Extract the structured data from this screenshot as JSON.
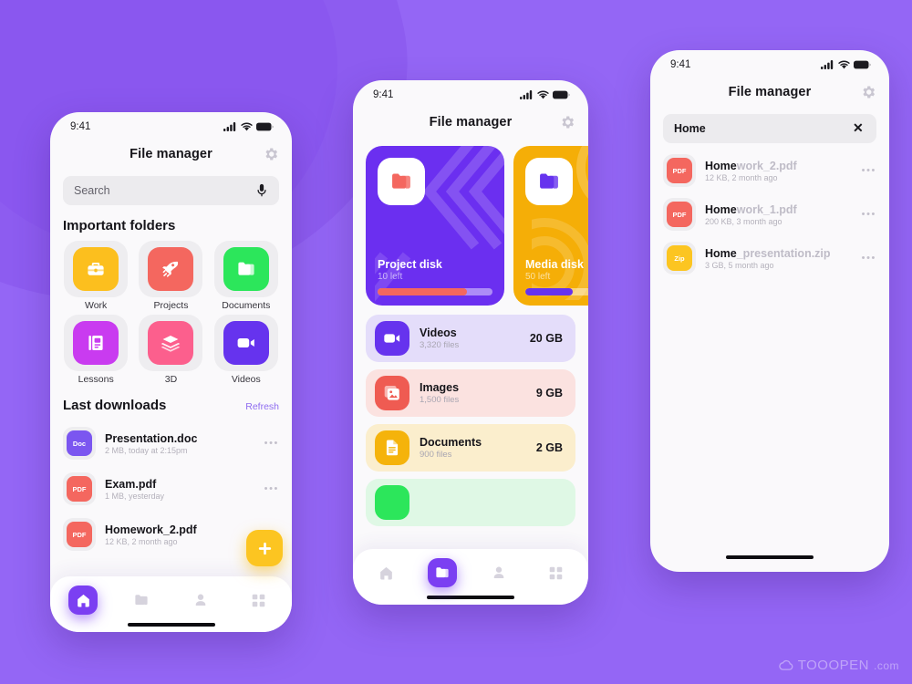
{
  "theme": {
    "background": "#9466f5",
    "blob": "#8d5cf0",
    "accent_purple": "#7b3ff2",
    "accent_yellow": "#fcc521",
    "accent_red": "#f4675f",
    "accent_green": "#2ce65b",
    "accent_pink": "#fc5f8d",
    "accent_magenta": "#c93bf0",
    "card_surface": "#faf9fb"
  },
  "watermark": {
    "brand": "TOOOPEN",
    "suffix": ".com",
    "icon": "cloud-icon"
  },
  "phone1": {
    "status": {
      "time": "9:41",
      "signal_icon": "cellular-signal-icon",
      "wifi_icon": "wifi-icon",
      "battery_icon": "battery-icon"
    },
    "header": {
      "title": "File manager",
      "settings_icon": "gear-icon"
    },
    "search": {
      "placeholder": "Search",
      "value": "",
      "mic_icon": "microphone-icon"
    },
    "folders_section": {
      "title": "Important folders"
    },
    "folders": [
      {
        "label": "Work",
        "icon": "briefcase-icon",
        "color": "#fcbf1e"
      },
      {
        "label": "Projects",
        "icon": "rocket-icon",
        "color": "#f4675f"
      },
      {
        "label": "Documents",
        "icon": "folder-icon",
        "color": "#2ce65b"
      },
      {
        "label": "Lessons",
        "icon": "book-icon",
        "color": "#c93bf0"
      },
      {
        "label": "3D",
        "icon": "layers-icon",
        "color": "#fc5f8d"
      },
      {
        "label": "Videos",
        "icon": "video-camera-icon",
        "color": "#6633ee"
      }
    ],
    "downloads_section": {
      "title": "Last downloads",
      "action": "Refresh"
    },
    "downloads": [
      {
        "name": "Presentation.doc",
        "meta": "2 MB, today at 2:15pm",
        "type": "Doc",
        "color": "#7b56f0"
      },
      {
        "name": "Exam.pdf",
        "meta": "1 MB, yesterday",
        "type": "PDF",
        "color": "#f4675f"
      },
      {
        "name": "Homework_2.pdf",
        "meta": "12 KB, 2 month ago",
        "type": "PDF",
        "color": "#f4675f"
      }
    ],
    "fab": {
      "icon": "plus-icon",
      "color": "#fcc521"
    },
    "nav": [
      {
        "name": "home",
        "icon": "home-icon",
        "active": true
      },
      {
        "name": "files",
        "icon": "folder-icon",
        "active": false
      },
      {
        "name": "profile",
        "icon": "person-icon",
        "active": false
      },
      {
        "name": "grid",
        "icon": "grid-icon",
        "active": false
      }
    ]
  },
  "phone2": {
    "status": {
      "time": "9:41",
      "signal_icon": "cellular-signal-icon",
      "wifi_icon": "wifi-icon",
      "battery_icon": "battery-icon"
    },
    "header": {
      "title": "File manager",
      "settings_icon": "gear-icon"
    },
    "disks": [
      {
        "name": "Project disk",
        "sub": "10 left",
        "card_color": "#6b2ff0",
        "icon": "folder-icon",
        "icon_color": "#f4675f",
        "fill_color": "#f4675f",
        "percent": 78
      },
      {
        "name": "Media disk",
        "sub": "50 left",
        "card_color": "#f5ae07",
        "icon": "folder-icon",
        "icon_color": "#6633ee",
        "fill_color": "#6633ee",
        "percent": 55
      }
    ],
    "categories": [
      {
        "name": "Videos",
        "files": "3,320 files",
        "size": "20 GB",
        "icon": "video-camera-icon",
        "icon_color": "#6633ee",
        "row_color": "#e4ddfa"
      },
      {
        "name": "Images",
        "files": "1,500 files",
        "size": "9 GB",
        "icon": "image-icon",
        "icon_color": "#ef5b52",
        "row_color": "#fbe2e0"
      },
      {
        "name": "Documents",
        "files": "900 files",
        "size": "2 GB",
        "icon": "document-icon",
        "icon_color": "#f5b30b",
        "row_color": "#fbeecd"
      },
      {
        "name": "",
        "files": "",
        "size": "",
        "icon": "music-icon",
        "icon_color": "#2ce65b",
        "row_color": "#dff8e5"
      }
    ],
    "nav": [
      {
        "name": "home",
        "icon": "home-icon",
        "active": false
      },
      {
        "name": "files",
        "icon": "folder-icon",
        "active": true
      },
      {
        "name": "profile",
        "icon": "person-icon",
        "active": false
      },
      {
        "name": "grid",
        "icon": "grid-icon",
        "active": false
      }
    ]
  },
  "phone3": {
    "status": {
      "time": "9:41",
      "signal_icon": "cellular-signal-icon",
      "wifi_icon": "wifi-icon",
      "battery_icon": "battery-icon"
    },
    "header": {
      "title": "File manager",
      "settings_icon": "gear-icon"
    },
    "search": {
      "value": "Home",
      "clear_icon": "close-icon"
    },
    "results": [
      {
        "match": "Home",
        "rest": "work_2.pdf",
        "meta": "12 KB, 2 month ago",
        "type": "PDF",
        "color": "#f4675f"
      },
      {
        "match": "Home",
        "rest": "work_1.pdf",
        "meta": "200 KB, 3 month ago",
        "type": "PDF",
        "color": "#f4675f"
      },
      {
        "match": "Home",
        "rest": "_presentation.zip",
        "meta": "3 GB, 5 month ago",
        "type": "Zip",
        "color": "#fcc521"
      }
    ]
  }
}
